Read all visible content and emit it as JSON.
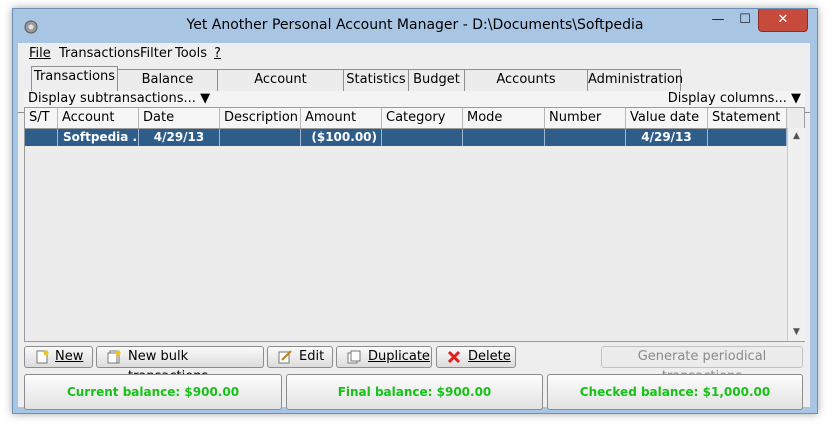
{
  "window": {
    "title": "Yet Another Personal Account Manager - D:\\Documents\\Softpedia",
    "min_label": "—",
    "max_label": "☐",
    "close_label": "✕"
  },
  "menu": {
    "items": [
      "File",
      "Transactions",
      "Filter",
      "Tools",
      "?"
    ]
  },
  "tabs": [
    "Transactions",
    "Balance history",
    "Account statements",
    "Statistics",
    "Budget",
    "Accounts summary",
    "Administration"
  ],
  "active_tab": "Transactions",
  "subbar": {
    "left": "Display subtransactions...",
    "right": "Display columns..."
  },
  "table": {
    "columns": [
      "S/T",
      "Account",
      "Date",
      "Description",
      "Amount",
      "Category",
      "Mode",
      "Number",
      "Value date",
      "Statement"
    ],
    "rows": [
      {
        "st": "",
        "account": "Softpedia ...",
        "date": "4/29/13",
        "description": "",
        "amount": "($100.00)",
        "category": "",
        "mode": "",
        "number": "",
        "value_date": "4/29/13",
        "statement": "",
        "selected": true
      }
    ]
  },
  "buttons": {
    "new": "New",
    "new_bulk": "New bulk transactions",
    "edit": "Edit",
    "duplicate": "Duplicate",
    "delete": "Delete",
    "generate_periodical": "Generate periodical transactions"
  },
  "balances": {
    "current": "Current balance: $900.00",
    "final": "Final balance: $900.00",
    "checked": "Checked balance: $1,000.00"
  },
  "colors": {
    "selection": "#2f5d8a",
    "balance_text": "#17c217",
    "close_button": "#c74b3c"
  }
}
